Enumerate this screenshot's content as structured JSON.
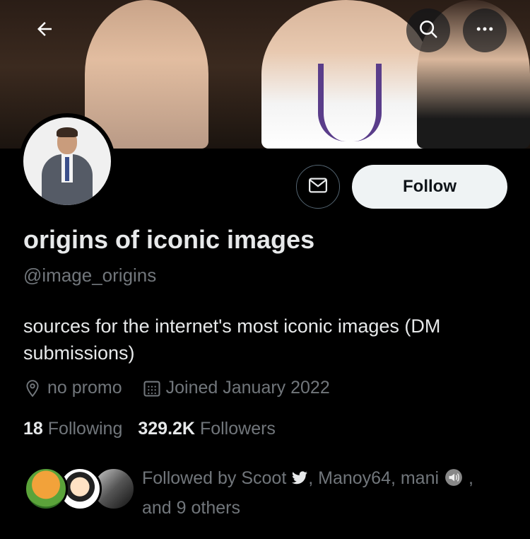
{
  "header": {
    "back_icon": "arrow-left-icon",
    "search_icon": "search-icon",
    "more_icon": "more-horizontal-icon"
  },
  "profile": {
    "display_name": "origins of iconic images",
    "handle": "@image_origins",
    "bio": "sources for the internet's most iconic images (DM submissions)",
    "location": "no promo",
    "joined": "Joined January 2022",
    "following_count": "18",
    "following_label": "Following",
    "followers_count": "329.2K",
    "followers_label": "Followers"
  },
  "actions": {
    "message_icon": "mail-icon",
    "follow_label": "Follow"
  },
  "followed_by": {
    "prefix": "Followed by Scoot",
    "mid": ", Manoy64, mani",
    "suffix": " ,",
    "line2": "and 9 others"
  },
  "colors": {
    "background": "#000000",
    "primary_text": "#e7e9ea",
    "secondary_text": "#71767b",
    "button_bg": "#eff3f4"
  }
}
